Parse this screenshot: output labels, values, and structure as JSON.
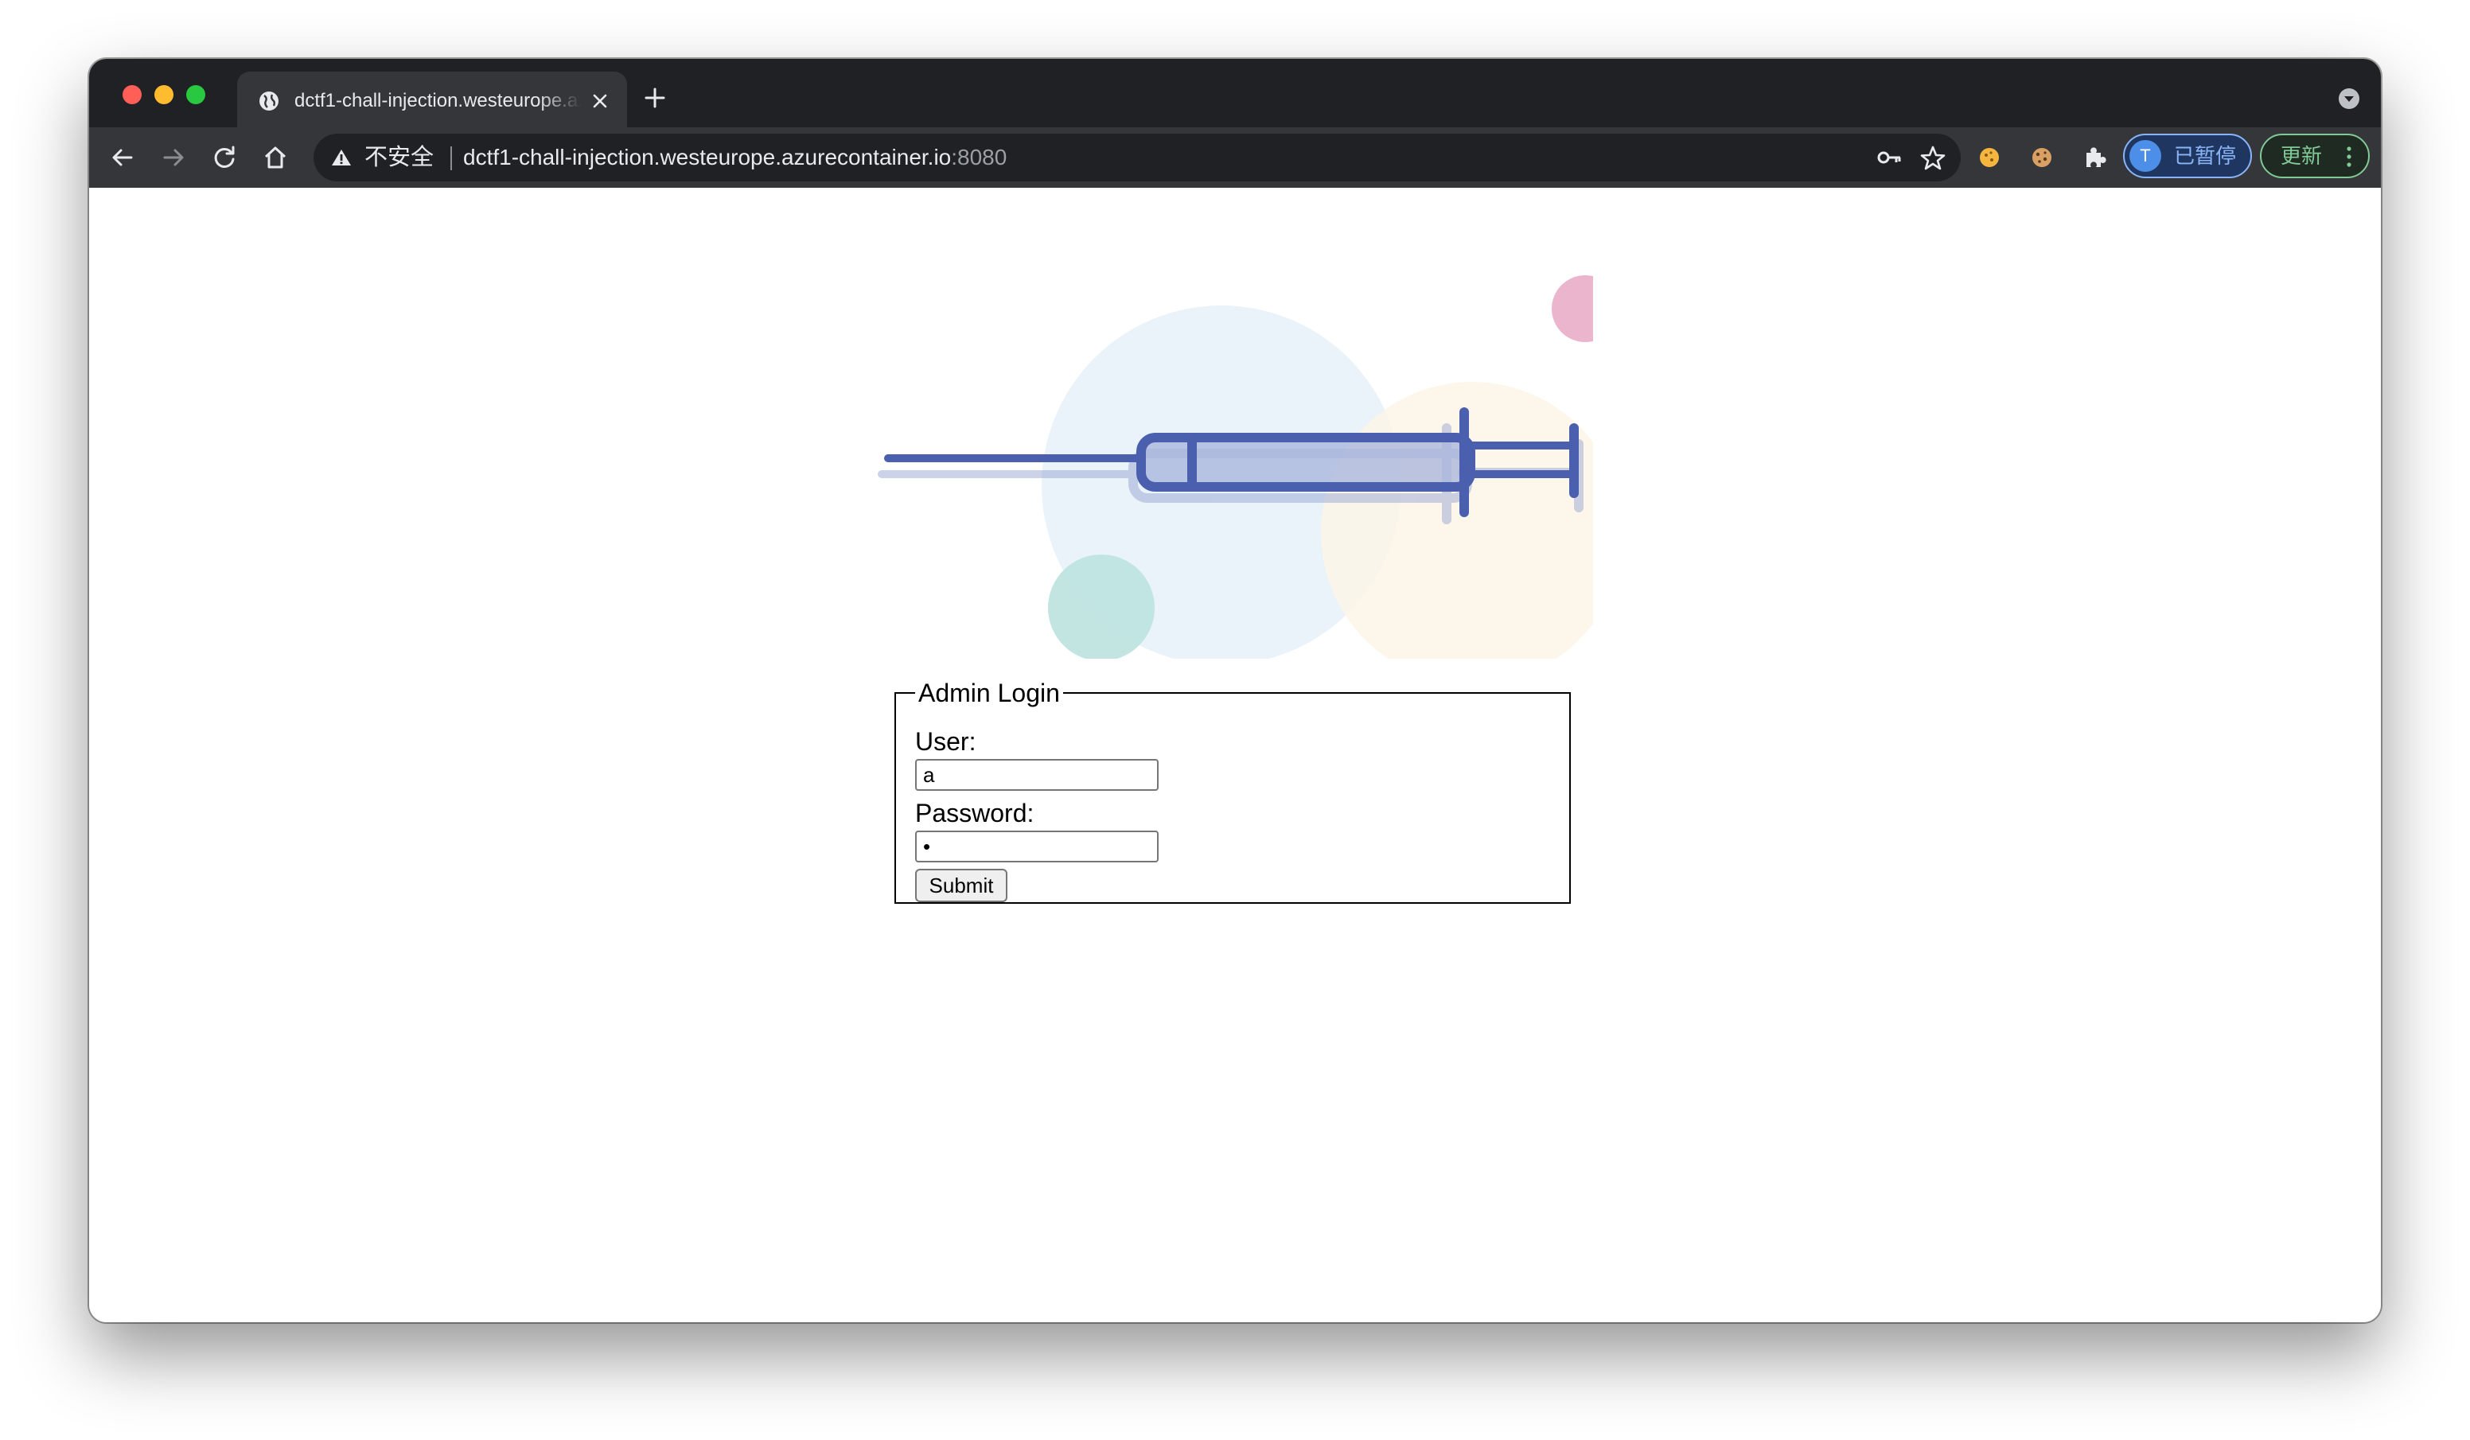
{
  "browser": {
    "tab": {
      "title": "dctf1-chall-injection.westeurope.azurecontainer.io:8080",
      "favicon": "globe-icon"
    },
    "toolbar": {
      "security_label": "不安全",
      "url_host": "dctf1-chall-injection.westeurope.azurecontainer.io",
      "url_port": ":8080",
      "profile_initial": "T",
      "profile_label": "已暂停",
      "update_label": "更新"
    },
    "icons": [
      "back-icon",
      "forward-icon",
      "reload-icon",
      "home-icon",
      "warning-icon",
      "key-icon",
      "star-icon",
      "cookie-extension-icon",
      "cookie-editor-icon",
      "puzzle-icon",
      "kebab-menu-icon"
    ]
  },
  "page": {
    "logo": "syringe-illustration",
    "form": {
      "legend": "Admin Login",
      "user_label": "User:",
      "user_value": "a",
      "password_label": "Password:",
      "password_value": "•",
      "submit_label": "Submit"
    }
  },
  "colors": {
    "chrome_dark": "#202124",
    "chrome_toolbar": "#35363a",
    "syringe_blue": "#4a5fad",
    "circle_blue": "#eaf3fa",
    "circle_cream": "#fdf5e7",
    "circle_pink": "#ebb6cd",
    "circle_teal": "#bfe4e0"
  }
}
